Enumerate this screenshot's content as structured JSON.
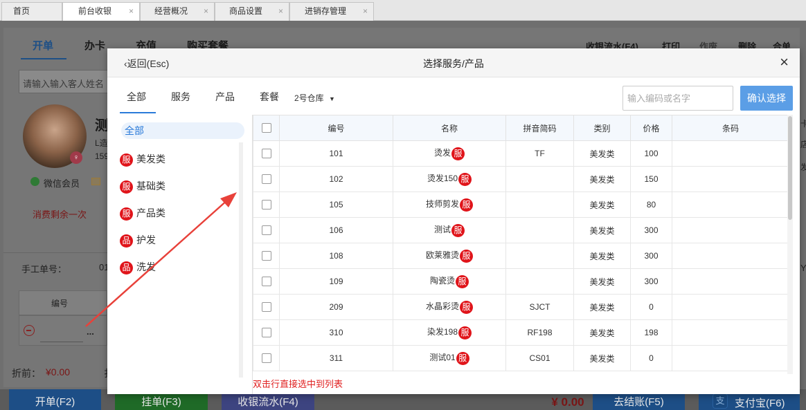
{
  "tabs": [
    {
      "label": "首页",
      "closable": false
    },
    {
      "label": "前台收银",
      "closable": true
    },
    {
      "label": "经营概况",
      "closable": true
    },
    {
      "label": "商品设置",
      "closable": true
    },
    {
      "label": "进销存管理",
      "closable": true
    }
  ],
  "tab_close": "×",
  "background": {
    "nav": [
      "开单",
      "办卡",
      "充值",
      "购买套餐"
    ],
    "right_nav": [
      "收银流水(F4)",
      "打印",
      "作废",
      "删除",
      "合单"
    ],
    "search_placeholder": "请输入输入客人姓名",
    "member_name": "测",
    "member_line1": "L造",
    "member_line2": "159",
    "wechat": "微信会员",
    "remaining": "消费剩余一次",
    "manual_order_label": "手工单号：",
    "manual_order_value": "01",
    "col_code": "编号",
    "ellipsis": "...",
    "discount_label": "折前：",
    "discount_value": "¥0.00",
    "total": "¥ 0.00",
    "side_r1": "卡",
    "side_r2": "店",
    "side_r3": "发",
    "side_r4": "Y",
    "bottom_buttons": [
      {
        "label": "开单(F2)",
        "color": "#2a74c4"
      },
      {
        "label": "挂单(F3)",
        "color": "#2f9a3a"
      },
      {
        "label": "收银流水(F4)",
        "color": "#5a63b0"
      },
      {
        "label": "去结账(F5)",
        "color": "#2a74c4"
      },
      {
        "label": "支付宝(F6)",
        "color": "#2a74c4"
      }
    ]
  },
  "modal": {
    "back": "返回(Esc)",
    "title": "选择服务/产品",
    "close": "×",
    "filter_tabs": [
      "全部",
      "服务",
      "产品",
      "套餐"
    ],
    "warehouse": "2号仓库",
    "warehouse_arrow": "▼",
    "search_placeholder": "输入编码或名字",
    "confirm": "确认选择",
    "categories": [
      {
        "label": "全部",
        "badge": ""
      },
      {
        "label": "美发类",
        "badge": "服"
      },
      {
        "label": "基础类",
        "badge": "服"
      },
      {
        "label": "产品类",
        "badge": "服"
      },
      {
        "label": "护发",
        "badge": "品"
      },
      {
        "label": "洗发",
        "badge": "品"
      }
    ],
    "columns": [
      "编号",
      "名称",
      "拼音简码",
      "类别",
      "价格",
      "条码"
    ],
    "rows": [
      {
        "code": "101",
        "name": "烫发",
        "badge": "服",
        "py": "TF",
        "cat": "美发类",
        "price": "100",
        "barcode": ""
      },
      {
        "code": "102",
        "name": "烫发150",
        "badge": "服",
        "py": "",
        "cat": "美发类",
        "price": "150",
        "barcode": ""
      },
      {
        "code": "105",
        "name": "技师剪发",
        "badge": "服",
        "py": "",
        "cat": "美发类",
        "price": "80",
        "barcode": ""
      },
      {
        "code": "106",
        "name": "测试",
        "badge": "服",
        "py": "",
        "cat": "美发类",
        "price": "300",
        "barcode": ""
      },
      {
        "code": "108",
        "name": "欧莱雅烫",
        "badge": "服",
        "py": "",
        "cat": "美发类",
        "price": "300",
        "barcode": ""
      },
      {
        "code": "109",
        "name": "陶瓷烫",
        "badge": "服",
        "py": "",
        "cat": "美发类",
        "price": "300",
        "barcode": ""
      },
      {
        "code": "209",
        "name": "水晶彩烫",
        "badge": "服",
        "py": "SJCT",
        "cat": "美发类",
        "price": "0",
        "barcode": ""
      },
      {
        "code": "310",
        "name": "染发198",
        "badge": "服",
        "py": "RF198",
        "cat": "美发类",
        "price": "198",
        "barcode": ""
      },
      {
        "code": "311",
        "name": "测试01",
        "badge": "服",
        "py": "CS01",
        "cat": "美发类",
        "price": "0",
        "barcode": ""
      }
    ],
    "hint": "双击行直接选中到列表"
  },
  "colors": {
    "accent": "#2a7ad9",
    "badge": "#e0141a",
    "confirm": "#5b9ee6",
    "arrow": "#e8413a"
  }
}
